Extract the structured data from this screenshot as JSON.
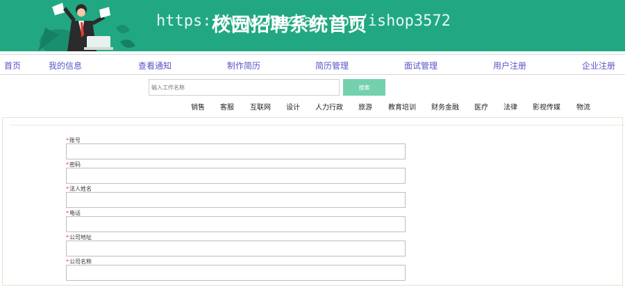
{
  "header": {
    "title": "校园招聘系统首页",
    "watermark": "https://www.huzhan.com/ishop3572",
    "background_color": "#21a882"
  },
  "nav": {
    "items": [
      "首页",
      "我的信息",
      "查看通知",
      "制作简历",
      "简历管理",
      "面试管理",
      "用户注册",
      "企业注册"
    ],
    "color": "#5b53c9"
  },
  "search": {
    "placeholder": "输入工作名称",
    "button_label": "搜索",
    "button_color": "#73d1ad"
  },
  "categories": [
    "销售",
    "客服",
    "互联网",
    "设计",
    "人力行政",
    "旅游",
    "教育培训",
    "财务金融",
    "医疗",
    "法律",
    "影视传媒",
    "物流"
  ],
  "form": {
    "required_mark": "*",
    "fields": [
      {
        "label": "账号"
      },
      {
        "label": "密码"
      },
      {
        "label": "法人姓名"
      },
      {
        "label": "电话"
      },
      {
        "label": "公司地址"
      },
      {
        "label": "公司名称"
      }
    ]
  }
}
